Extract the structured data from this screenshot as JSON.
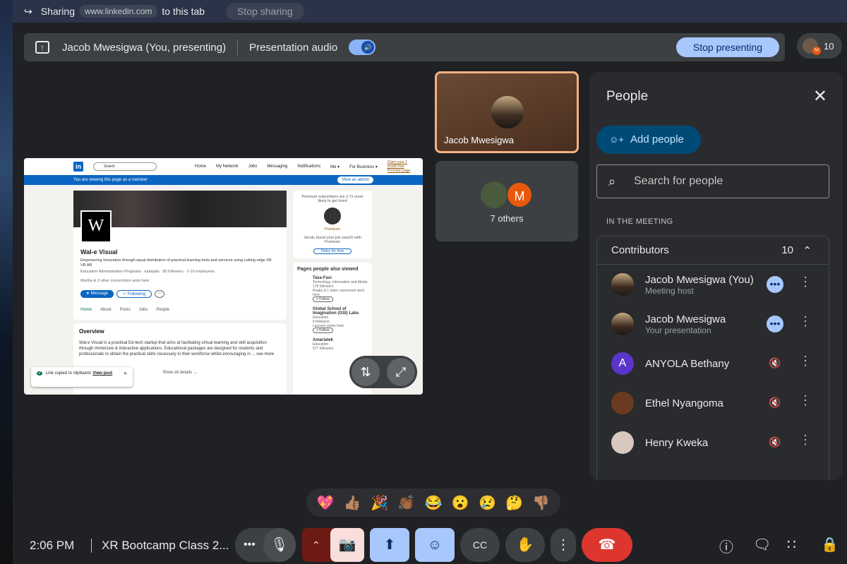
{
  "share_bar": {
    "label": "Sharing",
    "url": "www.linkedin.com",
    "suffix": "to this tab",
    "stop_label": "Stop sharing"
  },
  "present_bar": {
    "presenter": "Jacob Mwesigwa (You, presenting)",
    "audio_label": "Presentation audio",
    "stop_label": "Stop presenting"
  },
  "participant_count": "10",
  "linkedin": {
    "search_placeholder": "Search",
    "nav": [
      "Home",
      "My Network",
      "Jobs",
      "Messaging",
      "Notifications",
      "Me ▾",
      "For Business ▾",
      "Claim your 1 month free Premium page"
    ],
    "member_notice": "You are viewing this page as a member",
    "view_admin": "View as admin",
    "company_name": "Wal-e Visual",
    "tagline": "Empowering Innovation through equal distribution of practical learning tools and services using cutting edge XR VR AR",
    "meta": "Education Administration Programs · kampala · 80 followers · 2-10 employees",
    "connections": "Martha & 2 other connections work here",
    "message_btn": "➤ Message",
    "following_btn": "✓ Following",
    "tabs": [
      "Home",
      "About",
      "Posts",
      "Jobs",
      "People"
    ],
    "overview_title": "Overview",
    "overview_text": "Wal-e Visual is a practical Ed-tech startup that aims at facilitating virtual learning and skill acquisition through immersive & interactive applications. Educational packages are designed for students and professionals to obtain the practical skills necessary in their workforce whilst encouraging in ... see more",
    "show_all": "Show all details →",
    "premium_text": "Premium subscribers are 2.7x more likely to get hired",
    "premium_label": "Premium",
    "boost_text": "Jacob, boost your job search with Premium",
    "retry_btn": "Retry for free",
    "pages_viewed_title": "Pages people also viewed",
    "pages": [
      {
        "name": "Taza-Fasi",
        "industry": "Technology, Information and Media",
        "followers": "178 followers",
        "note": "Khaka & 1 other connection work here"
      },
      {
        "name": "Global School of Imagination (GSI) Labs",
        "industry": "Education",
        "followers": "6 followers",
        "note": "Laureen works here"
      },
      {
        "name": "Amariatek",
        "industry": "Education",
        "followers": "577 followers",
        "note": ""
      }
    ],
    "follow_btn": "+ Follow",
    "toast_text": "Link copied to clipboard.",
    "toast_link": "View post"
  },
  "tiles": [
    {
      "name": "Jacob Mwesigwa"
    },
    {
      "name": "7 others"
    }
  ],
  "people_panel": {
    "title": "People",
    "add_people": "Add people",
    "search_placeholder": "Search for people",
    "section_label": "IN THE MEETING",
    "group_label": "Contributors",
    "group_count": "10",
    "participants": [
      {
        "name": "Jacob Mwesigwa (You)",
        "sub": "Meeting host",
        "avatar": "photo",
        "status": "more"
      },
      {
        "name": "Jacob Mwesigwa",
        "sub": "Your presentation",
        "avatar": "photo",
        "status": "more"
      },
      {
        "name": "ANYOLA Bethany",
        "sub": "",
        "avatar": "A",
        "status": "muted"
      },
      {
        "name": "Ethel Nyangoma",
        "sub": "",
        "avatar": "photo",
        "status": "muted"
      },
      {
        "name": "Henry Kweka",
        "sub": "",
        "avatar": "photo",
        "status": "muted"
      }
    ]
  },
  "reactions": [
    "💖",
    "👍🏽",
    "🎉",
    "👏🏾",
    "😂",
    "😮",
    "😢",
    "🤔",
    "👎🏽"
  ],
  "bottom": {
    "time": "2:06 PM",
    "meeting_title": "XR Bootcamp Class 2..."
  },
  "colors": {
    "accent": "#a8c7fa",
    "end_call": "#dc362e",
    "camera_off": "#f9dedc",
    "addpeople": "#004a77"
  }
}
